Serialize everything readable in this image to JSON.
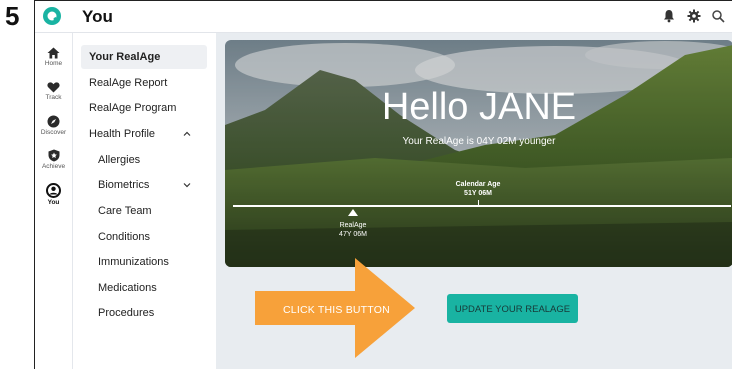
{
  "step_number": "5",
  "header": {
    "title": "You"
  },
  "rail": [
    {
      "label": "Home",
      "icon": "home-icon"
    },
    {
      "label": "Track",
      "icon": "heart-icon"
    },
    {
      "label": "Discover",
      "icon": "compass-icon"
    },
    {
      "label": "Achieve",
      "icon": "shield-icon"
    },
    {
      "label": "You",
      "icon": "user-icon"
    }
  ],
  "menu": [
    {
      "label": "Your RealAge",
      "active": true
    },
    {
      "label": "RealAge Report"
    },
    {
      "label": "RealAge Program"
    },
    {
      "label": "Health Profile",
      "expanded": true
    },
    {
      "label": "Allergies"
    },
    {
      "label": "Biometrics"
    },
    {
      "label": "Care Team"
    },
    {
      "label": "Conditions"
    },
    {
      "label": "Immunizations"
    },
    {
      "label": "Medications"
    },
    {
      "label": "Procedures"
    }
  ],
  "hero": {
    "greeting": "Hello JANE",
    "subtitle": "Your RealAge is 04Y 02M younger",
    "calendar_age_label": "Calendar Age",
    "calendar_age_value": "51Y 06M",
    "realage_label": "RealAge",
    "realage_value": "47Y 06M"
  },
  "cta": {
    "label": "UPDATE YOUR REALAGE"
  },
  "annotation": {
    "text": "CLICK THIS BUTTON",
    "color": "#f7a13a"
  },
  "colors": {
    "accent": "#19b3a2",
    "background": "#e8ecf0"
  }
}
